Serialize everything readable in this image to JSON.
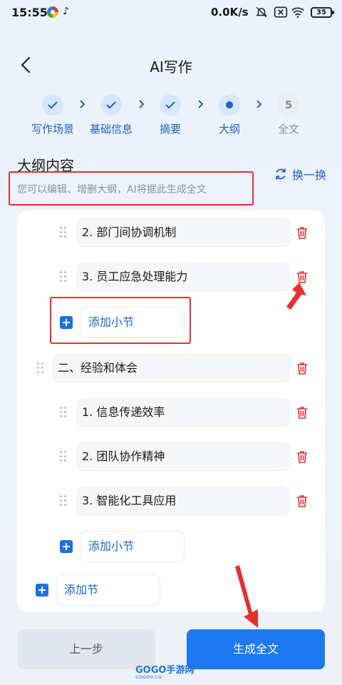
{
  "status_bar": {
    "time": "15:55",
    "app2": "♪",
    "network": "0.0K/s",
    "battery": "35"
  },
  "header": {
    "title": "AI写作"
  },
  "steps": [
    {
      "label": "写作场景",
      "state": "done"
    },
    {
      "label": "基础信息",
      "state": "done"
    },
    {
      "label": "摘要",
      "state": "done"
    },
    {
      "label": "大纲",
      "state": "current"
    },
    {
      "label": "全文",
      "state": "pending",
      "number": "5"
    }
  ],
  "outline": {
    "title": "大纲内容",
    "subtitle": "您可以编辑、增删大纲，AI将据此生成全文",
    "refresh_label": "换一换",
    "items": [
      "2. 部门间协调机制",
      "3. 员工应急处理能力",
      "二、经验和体会",
      "1. 信息传递效率",
      "2. 团队协作精神",
      "3. 智能化工具应用"
    ],
    "add_subsection_label": "添加小节",
    "add_section_label": "添加节"
  },
  "footer": {
    "prev_label": "上一步",
    "generate_label": "生成全文"
  },
  "watermark": {
    "text": "GOGO手游网",
    "sub": "GOGOO.CN"
  },
  "colors": {
    "accent": "#1e78f0",
    "danger": "#e53030",
    "step_done_bg": "#d7e6fb"
  }
}
